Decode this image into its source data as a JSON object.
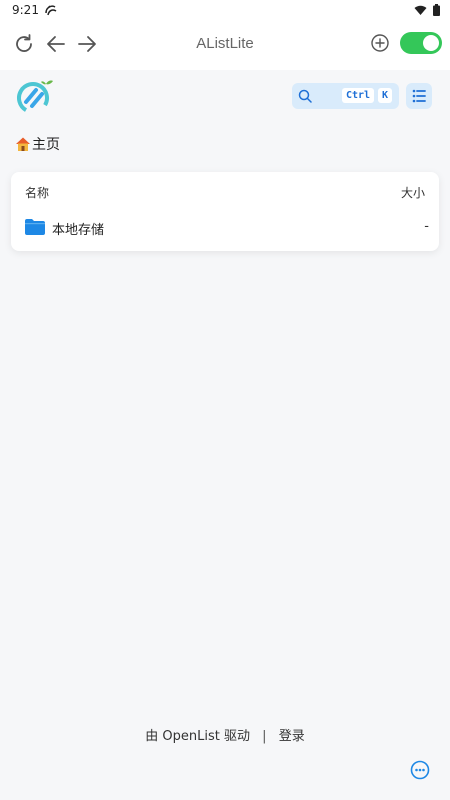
{
  "status_bar": {
    "time": "9:21"
  },
  "top_bar": {
    "title": "AListLite"
  },
  "search": {
    "kbd_ctrl": "Ctrl",
    "kbd_k": "K"
  },
  "breadcrumb": {
    "home_label": "主页"
  },
  "table": {
    "col_name": "名称",
    "col_size": "大小",
    "rows": [
      {
        "name": "本地存储",
        "size": "-"
      }
    ]
  },
  "footer": {
    "powered_by": "由 OpenList 驱动",
    "separator": "|",
    "login": "登录"
  },
  "colors": {
    "accent": "#1e88e5",
    "toggle": "#34c759",
    "search_bg": "#d9ebfb"
  },
  "icons": [
    "app-status-icon",
    "wifi-icon",
    "battery-icon",
    "refresh-icon",
    "back-arrow-icon",
    "forward-arrow-icon",
    "add-circle-icon",
    "toggle-switch",
    "logo-icon",
    "search-icon",
    "list-view-icon",
    "home-icon",
    "folder-icon",
    "more-icon"
  ]
}
